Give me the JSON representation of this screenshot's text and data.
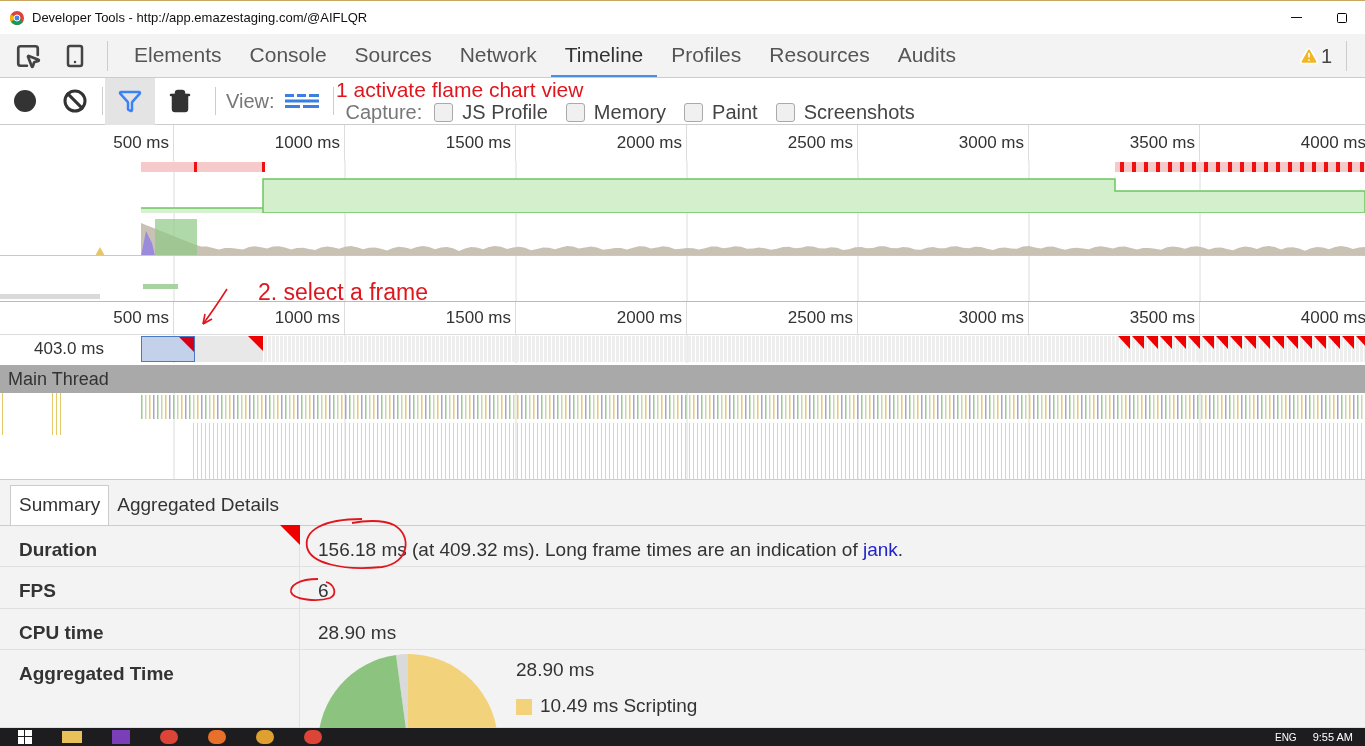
{
  "window": {
    "title": "Developer Tools - http://app.emazestaging.com/@AIFLQR"
  },
  "tabs": [
    {
      "label": "Elements",
      "selected": false
    },
    {
      "label": "Console",
      "selected": false
    },
    {
      "label": "Sources",
      "selected": false
    },
    {
      "label": "Network",
      "selected": false
    },
    {
      "label": "Timeline",
      "selected": true
    },
    {
      "label": "Profiles",
      "selected": false
    },
    {
      "label": "Resources",
      "selected": false
    },
    {
      "label": "Audits",
      "selected": false
    }
  ],
  "warnings": {
    "count": "1"
  },
  "toolbar": {
    "buttons": [
      {
        "kind": "record",
        "selected": false
      },
      {
        "kind": "clear",
        "selected": false
      },
      {
        "kind": "filter",
        "selected": true
      },
      {
        "kind": "trash",
        "selected": false
      }
    ],
    "view_label": "View:",
    "capture_label": "Capture:",
    "capture_options": [
      {
        "label": "JS Profile",
        "checked": false
      },
      {
        "label": "Memory",
        "checked": false
      },
      {
        "label": "Paint",
        "checked": false
      },
      {
        "label": "Screenshots",
        "checked": false
      }
    ]
  },
  "overview": {
    "ticks": [
      "500 ms",
      "1000 ms",
      "1500 ms",
      "2000 ms",
      "2500 ms",
      "3000 ms",
      "3500 ms",
      "4000 ms"
    ]
  },
  "flame": {
    "ticks": [
      "500 ms",
      "1000 ms",
      "1500 ms",
      "2000 ms",
      "2500 ms",
      "3000 ms",
      "3500 ms",
      "4000 ms"
    ],
    "frame_duration": "403.0 ms",
    "track_title": "Main Thread"
  },
  "annotations": [
    {
      "text": "1 activate flame chart view"
    },
    {
      "text": "2. select a frame"
    }
  ],
  "details": {
    "tabs": [
      {
        "label": "Summary",
        "selected": true
      },
      {
        "label": "Aggregated Details",
        "selected": false
      }
    ],
    "rows": [
      {
        "kind": "duration",
        "label": "Duration",
        "text": "156.18 ms (at 409.32 ms). Long frame times are an indication of",
        "link": "jank",
        "after": "."
      },
      {
        "kind": "plain",
        "label": "FPS",
        "value": "6"
      },
      {
        "kind": "plain",
        "label": "CPU time",
        "value": "28.90 ms"
      },
      {
        "kind": "pie",
        "label": "Aggregated Time",
        "total": "28.90 ms",
        "legend": [
          {
            "text": "10.49 ms Scripting",
            "color": "#f2d27a"
          }
        ]
      }
    ]
  },
  "taskbar": {
    "language": "ENG",
    "time": "9:55 AM"
  }
}
